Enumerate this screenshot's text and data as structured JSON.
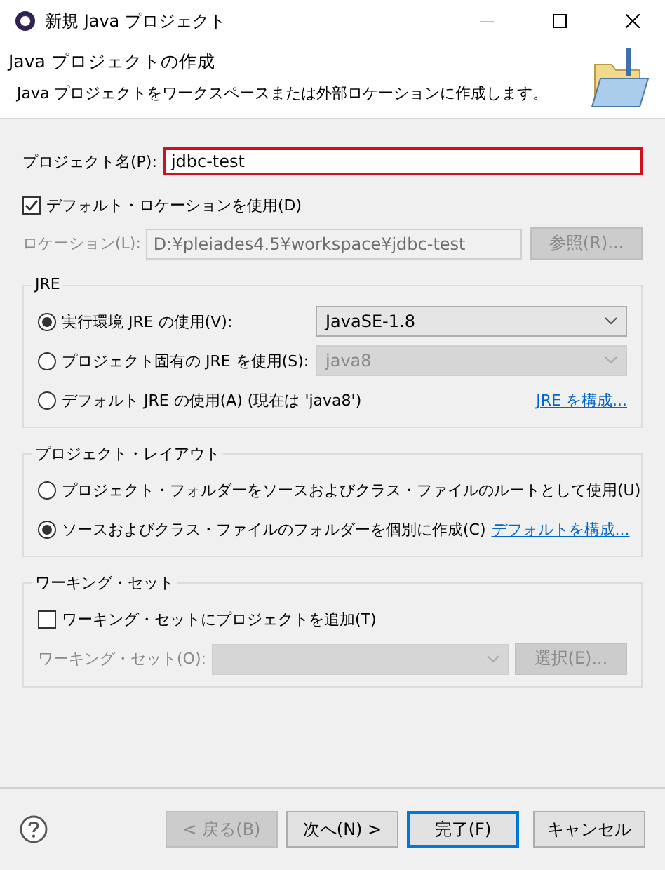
{
  "window": {
    "title": "新規 Java プロジェクト"
  },
  "header": {
    "title": "Java プロジェクトの作成",
    "description": "Java プロジェクトをワークスペースまたは外部ロケーションに作成します。"
  },
  "project_name": {
    "label": "プロジェクト名(P):",
    "value": "jdbc-test",
    "highlighted": true
  },
  "default_location": {
    "label": "デフォルト・ロケーションを使用(D)",
    "checked": true
  },
  "location": {
    "label": "ロケーション(L):",
    "value": "D:¥pleiades4.5¥workspace¥jdbc-test",
    "disabled": true,
    "button": {
      "label": "参照(R)...",
      "disabled": true
    }
  },
  "jre": {
    "title": "JRE",
    "options": [
      {
        "kind": "dropdown",
        "label": "実行環境 JRE の使用(V):",
        "selected": true,
        "value": "JavaSE-1.8",
        "disabled": false
      },
      {
        "kind": "dropdown",
        "label": "プロジェクト固有の JRE を使用(S):",
        "selected": false,
        "value": "java8",
        "disabled": true
      },
      {
        "kind": "link",
        "label": "デフォルト JRE の使用(A) (現在は 'java8')",
        "selected": false,
        "link": "JRE を構成..."
      }
    ]
  },
  "project_layout": {
    "title": "プロジェクト・レイアウト",
    "options": [
      {
        "kind": "plain",
        "label": "プロジェクト・フォルダーをソースおよびクラス・ファイルのルートとして使用(U)",
        "selected": false
      },
      {
        "kind": "link",
        "label": "ソースおよびクラス・ファイルのフォルダーを個別に作成(C)",
        "selected": true,
        "link": "デフォルトを構成..."
      }
    ]
  },
  "working_set": {
    "title": "ワーキング・セット",
    "checkbox": {
      "label": "ワーキング・セットにプロジェクトを追加(T)",
      "checked": false
    },
    "field": {
      "label": "ワーキング・セット(O):",
      "disabled": true
    },
    "button": {
      "label": "選択(E)...",
      "disabled": true
    }
  },
  "buttons": [
    {
      "label": "< 戻る(B)",
      "disabled": true,
      "default": false
    },
    {
      "label": "次へ(N) >",
      "disabled": false,
      "default": false
    },
    {
      "label": "完了(F)",
      "disabled": false,
      "default": true
    },
    {
      "label": "キャンセル",
      "disabled": false,
      "default": false
    }
  ]
}
